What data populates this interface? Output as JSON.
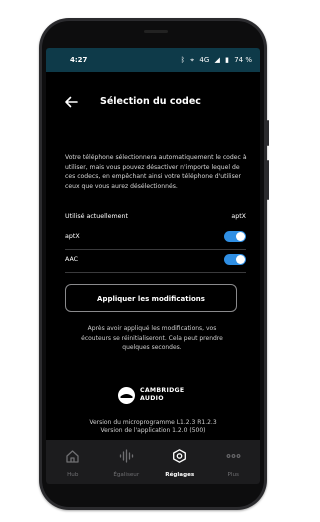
{
  "status_bar": {
    "time": "4:27",
    "icons": [
      "bluetooth-icon",
      "location-icon",
      "network-4g-icon",
      "signal-icon"
    ],
    "network": "4G",
    "battery": "74 %"
  },
  "header": {
    "title": "Sélection du codec"
  },
  "description": "Votre téléphone sélectionnera automatiquement le codec à utiliser, mais vous pouvez désactiver n'importe lequel de ces codecs, en empêchant ainsi votre téléphone d'utiliser ceux que vous aurez désélectionnés.",
  "current": {
    "label": "Utilisé actuellement",
    "value": "aptX"
  },
  "codecs": [
    {
      "label": "aptX",
      "enabled": true
    },
    {
      "label": "AAC",
      "enabled": true
    }
  ],
  "apply_button": "Appliquer les modifications",
  "note": "Après avoir appliqué les modifications, vos écouteurs se réinitialiseront. Cela peut prendre quelques secondes.",
  "brand": {
    "line1": "CAMBRIDGE",
    "line2": "AUDIO"
  },
  "versions": {
    "firmware": "Version du microprogramme L1.2.3  R1.2.3",
    "app": "Version de l'application 1.2.0 (500)"
  },
  "tabs": [
    {
      "label": "Hub",
      "icon": "home-icon",
      "active": false
    },
    {
      "label": "Égaliseur",
      "icon": "equalizer-icon",
      "active": false
    },
    {
      "label": "Réglages",
      "icon": "settings-icon",
      "active": true
    },
    {
      "label": "Plus",
      "icon": "more-icon",
      "active": false
    }
  ],
  "colors": {
    "status_bar": "#0e3a49",
    "toggle_on": "#2f8fe4",
    "background": "#000000",
    "tab_bar": "#1c1c1e"
  }
}
